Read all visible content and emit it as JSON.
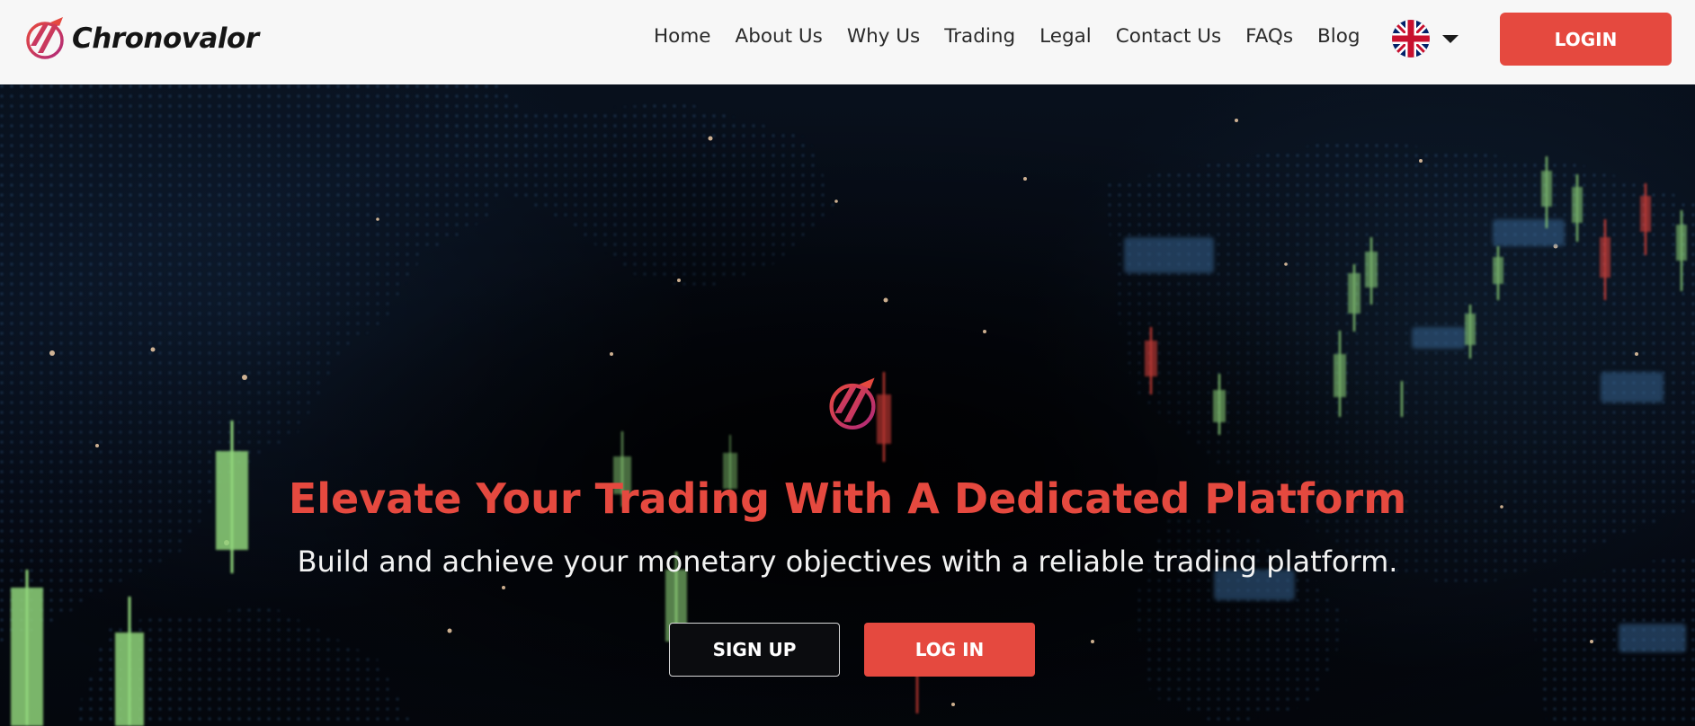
{
  "brand": {
    "name": "Chronovalor",
    "logo_icon": "chronovalor-logo-icon"
  },
  "nav": {
    "items": [
      {
        "label": "Home"
      },
      {
        "label": "About Us"
      },
      {
        "label": "Why Us"
      },
      {
        "label": "Trading"
      },
      {
        "label": "Legal"
      },
      {
        "label": "Contact Us"
      },
      {
        "label": "FAQs"
      },
      {
        "label": "Blog"
      }
    ],
    "language_icon": "uk-flag-icon",
    "dropdown_icon": "caret-down-icon"
  },
  "header": {
    "login_label": "LOGIN"
  },
  "hero": {
    "headline": "Elevate Your Trading With A Dedicated Platform",
    "subheadline": "Build and achieve your monetary objectives with a reliable trading platform.",
    "signup_label": "SIGN UP",
    "login_label": "LOG IN",
    "background": "world-map-candlestick-background"
  },
  "colors": {
    "accent": "#e5493f",
    "header_bg": "#f7f7f7",
    "hero_bg": "#05080f",
    "candle_green": "#8fd47a",
    "candle_red": "#e0433a"
  }
}
